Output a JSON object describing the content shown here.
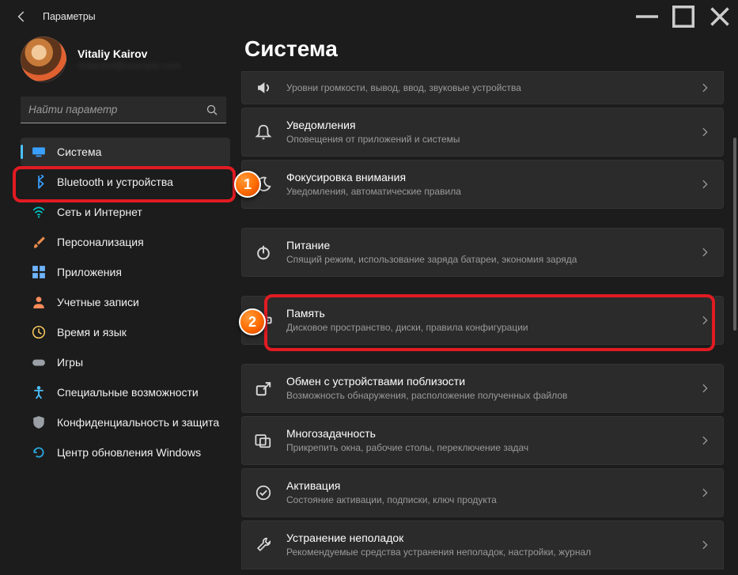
{
  "window": {
    "title": "Параметры"
  },
  "user": {
    "name": "Vitaliy Kairov",
    "email": "redacted@example.com"
  },
  "search": {
    "placeholder": "Найти параметр"
  },
  "sidebar": {
    "items": [
      {
        "label": "Система",
        "icon": "monitor",
        "color": "#3aa0ff",
        "active": true
      },
      {
        "label": "Bluetooth и устройства",
        "icon": "bluetooth",
        "color": "#3aa0ff"
      },
      {
        "label": "Сеть и Интернет",
        "icon": "wifi",
        "color": "#00c2c2"
      },
      {
        "label": "Персонализация",
        "icon": "brush",
        "color": "#e88b4a"
      },
      {
        "label": "Приложения",
        "icon": "apps",
        "color": "#6fb4ff"
      },
      {
        "label": "Учетные записи",
        "icon": "person",
        "color": "#ff8c5a"
      },
      {
        "label": "Время и язык",
        "icon": "clock",
        "color": "#ffd060"
      },
      {
        "label": "Игры",
        "icon": "gamepad",
        "color": "#9aa0a6"
      },
      {
        "label": "Специальные возможности",
        "icon": "accessibility",
        "color": "#4cc2ff"
      },
      {
        "label": "Конфиденциальность и защита",
        "icon": "shield",
        "color": "#9aa0a6"
      },
      {
        "label": "Центр обновления Windows",
        "icon": "update",
        "color": "#2aa8e0"
      }
    ]
  },
  "main": {
    "title": "Система",
    "panels": [
      {
        "title": "",
        "sub": "Уровни громкости, вывод, ввод, звуковые устройства",
        "icon": "sound"
      },
      {
        "title": "Уведомления",
        "sub": "Оповещения от приложений и системы",
        "icon": "bell"
      },
      {
        "title": "Фокусировка внимания",
        "sub": "Уведомления, автоматические правила",
        "icon": "moon"
      },
      {
        "title": "Питание",
        "sub": "Спящий режим, использование заряда батареи, экономия заряда",
        "icon": "power"
      },
      {
        "title": "Память",
        "sub": "Дисковое пространство, диски, правила конфигурации",
        "icon": "storage"
      },
      {
        "title": "Обмен с устройствами поблизости",
        "sub": "Возможность обнаружения, расположение полученных файлов",
        "icon": "share"
      },
      {
        "title": "Многозадачность",
        "sub": "Прикрепить окна, рабочие столы, переключение задач",
        "icon": "multitask"
      },
      {
        "title": "Активация",
        "sub": "Состояние активации, подписки, ключ продукта",
        "icon": "check"
      },
      {
        "title": "Устранение неполадок",
        "sub": "Рекомендуемые средства устранения неполадок, настройки, журнал",
        "icon": "wrench"
      }
    ]
  },
  "callouts": {
    "one": "1",
    "two": "2"
  }
}
